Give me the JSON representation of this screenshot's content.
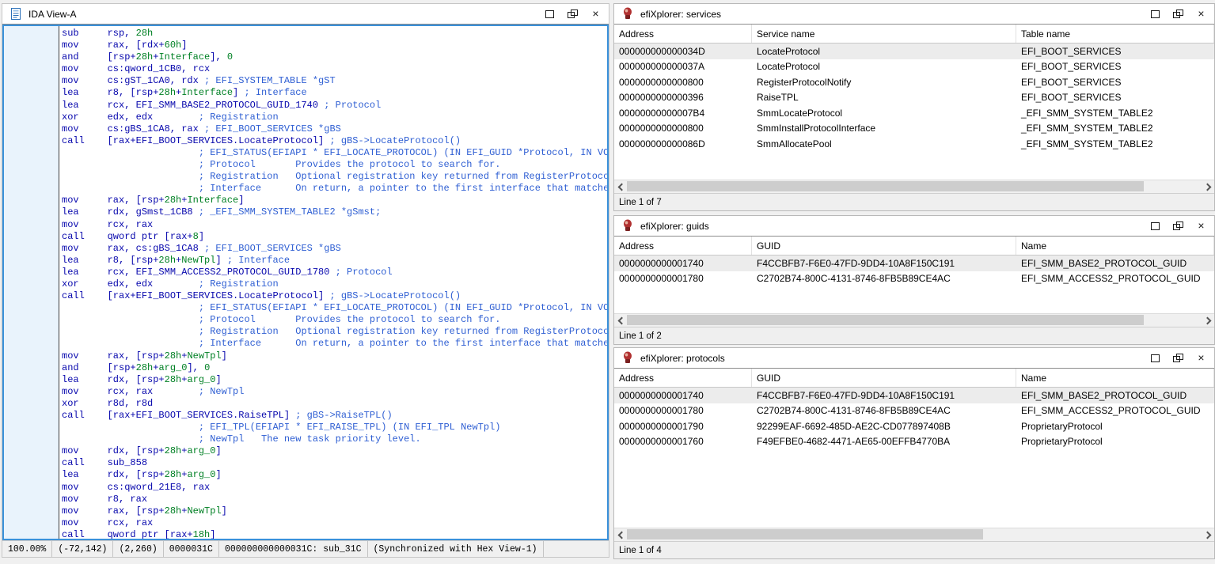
{
  "colors": {
    "accent_focus_border": "#3a91da",
    "code_navy": "#0707ad",
    "code_green": "#008024",
    "comment_blue": "#2f5fd3",
    "selected_row": "#ececec",
    "gutter_blue": "#e9f3fc"
  },
  "ida_view": {
    "title": "IDA View-A",
    "status_cells": [
      "100.00%",
      "(-72,142)",
      "(2,260)",
      "0000031C",
      "000000000000031C: sub_31C",
      "(Synchronized with Hex View-1)"
    ],
    "lines": [
      [
        [
          "c",
          "sub     rsp, "
        ],
        [
          "g",
          "28h"
        ]
      ],
      [
        [
          "c",
          "mov     rax, [rdx+"
        ],
        [
          "g",
          "60h"
        ],
        [
          "c",
          "]"
        ]
      ],
      [
        [
          "c",
          "and     [rsp+"
        ],
        [
          "g",
          "28h"
        ],
        [
          "c",
          "+"
        ],
        [
          "g",
          "Interface"
        ],
        [
          "c",
          "], "
        ],
        [
          "g",
          "0"
        ]
      ],
      [
        [
          "c",
          "mov     cs:qword_1CB0, rcx"
        ]
      ],
      [
        [
          "c",
          "mov     cs:gST_1CA0, rdx "
        ],
        [
          "b",
          "; EFI_SYSTEM_TABLE *gST"
        ]
      ],
      [
        [
          "c",
          "lea     r8, [rsp+"
        ],
        [
          "g",
          "28h"
        ],
        [
          "c",
          "+"
        ],
        [
          "g",
          "Interface"
        ],
        [
          "c",
          "] "
        ],
        [
          "b",
          "; Interface"
        ]
      ],
      [
        [
          "c",
          "lea     rcx, EFI_SMM_BASE2_PROTOCOL_GUID_1740 "
        ],
        [
          "b",
          "; Protocol"
        ]
      ],
      [
        [
          "c",
          "xor     edx, edx        "
        ],
        [
          "b",
          "; Registration"
        ]
      ],
      [
        [
          "c",
          "mov     cs:gBS_1CA8, rax "
        ],
        [
          "b",
          "; EFI_BOOT_SERVICES *gBS"
        ]
      ],
      [
        [
          "c",
          "call    [rax+EFI_BOOT_SERVICES.LocateProtocol] "
        ],
        [
          "b",
          "; gBS->LocateProtocol()"
        ]
      ],
      [
        [
          "b",
          "                        ; EFI_STATUS(EFIAPI * EFI_LOCATE_PROTOCOL) (IN EFI_GUID *Protocol, IN VOID"
        ]
      ],
      [
        [
          "b",
          "                        ; Protocol       Provides the protocol to search for."
        ]
      ],
      [
        [
          "b",
          "                        ; Registration   Optional registration key returned from RegisterProtocolNo"
        ]
      ],
      [
        [
          "b",
          "                        ; Interface      On return, a pointer to the first interface that matches t"
        ]
      ],
      [
        [
          "c",
          "mov     rax, [rsp+"
        ],
        [
          "g",
          "28h"
        ],
        [
          "c",
          "+"
        ],
        [
          "g",
          "Interface"
        ],
        [
          "c",
          "]"
        ]
      ],
      [
        [
          "c",
          "lea     rdx, gSmst_1CB8 "
        ],
        [
          "b",
          "; _EFI_SMM_SYSTEM_TABLE2 *gSmst;"
        ]
      ],
      [
        [
          "c",
          "mov     rcx, rax"
        ]
      ],
      [
        [
          "c",
          "call    qword ptr [rax+"
        ],
        [
          "g",
          "8"
        ],
        [
          "c",
          "]"
        ]
      ],
      [
        [
          "c",
          "mov     rax, cs:gBS_1CA8 "
        ],
        [
          "b",
          "; EFI_BOOT_SERVICES *gBS"
        ]
      ],
      [
        [
          "c",
          "lea     r8, [rsp+"
        ],
        [
          "g",
          "28h"
        ],
        [
          "c",
          "+"
        ],
        [
          "g",
          "NewTpl"
        ],
        [
          "c",
          "] "
        ],
        [
          "b",
          "; Interface"
        ]
      ],
      [
        [
          "c",
          "lea     rcx, EFI_SMM_ACCESS2_PROTOCOL_GUID_1780 "
        ],
        [
          "b",
          "; Protocol"
        ]
      ],
      [
        [
          "c",
          "xor     edx, edx        "
        ],
        [
          "b",
          "; Registration"
        ]
      ],
      [
        [
          "c",
          "call    [rax+EFI_BOOT_SERVICES.LocateProtocol] "
        ],
        [
          "b",
          "; gBS->LocateProtocol()"
        ]
      ],
      [
        [
          "b",
          "                        ; EFI_STATUS(EFIAPI * EFI_LOCATE_PROTOCOL) (IN EFI_GUID *Protocol, IN VOID"
        ]
      ],
      [
        [
          "b",
          "                        ; Protocol       Provides the protocol to search for."
        ]
      ],
      [
        [
          "b",
          "                        ; Registration   Optional registration key returned from RegisterProtocolNo"
        ]
      ],
      [
        [
          "b",
          "                        ; Interface      On return, a pointer to the first interface that matches t"
        ]
      ],
      [
        [
          "c",
          "mov     rax, [rsp+"
        ],
        [
          "g",
          "28h"
        ],
        [
          "c",
          "+"
        ],
        [
          "g",
          "NewTpl"
        ],
        [
          "c",
          "]"
        ]
      ],
      [
        [
          "c",
          "and     [rsp+"
        ],
        [
          "g",
          "28h"
        ],
        [
          "c",
          "+"
        ],
        [
          "g",
          "arg_0"
        ],
        [
          "c",
          "], "
        ],
        [
          "g",
          "0"
        ]
      ],
      [
        [
          "c",
          "lea     rdx, [rsp+"
        ],
        [
          "g",
          "28h"
        ],
        [
          "c",
          "+"
        ],
        [
          "g",
          "arg_0"
        ],
        [
          "c",
          "]"
        ]
      ],
      [
        [
          "c",
          "mov     rcx, rax        "
        ],
        [
          "b",
          "; NewTpl"
        ]
      ],
      [
        [
          "c",
          "xor     r8d, r8d"
        ]
      ],
      [
        [
          "c",
          "call    [rax+EFI_BOOT_SERVICES.RaiseTPL] "
        ],
        [
          "b",
          "; gBS->RaiseTPL()"
        ]
      ],
      [
        [
          "b",
          "                        ; EFI_TPL(EFIAPI * EFI_RAISE_TPL) (IN EFI_TPL NewTpl)"
        ]
      ],
      [
        [
          "b",
          "                        ; NewTpl   The new task priority level."
        ]
      ],
      [
        [
          "c",
          "mov     rdx, [rsp+"
        ],
        [
          "g",
          "28h"
        ],
        [
          "c",
          "+"
        ],
        [
          "g",
          "arg_0"
        ],
        [
          "c",
          "]"
        ]
      ],
      [
        [
          "c",
          "call    sub_858"
        ]
      ],
      [
        [
          "c",
          "lea     rdx, [rsp+"
        ],
        [
          "g",
          "28h"
        ],
        [
          "c",
          "+"
        ],
        [
          "g",
          "arg_0"
        ],
        [
          "c",
          "]"
        ]
      ],
      [
        [
          "c",
          "mov     cs:qword_21E8, rax"
        ]
      ],
      [
        [
          "c",
          "mov     r8, rax"
        ]
      ],
      [
        [
          "c",
          "mov     rax, [rsp+"
        ],
        [
          "g",
          "28h"
        ],
        [
          "c",
          "+"
        ],
        [
          "g",
          "NewTpl"
        ],
        [
          "c",
          "]"
        ]
      ],
      [
        [
          "c",
          "mov     rcx, rax"
        ]
      ],
      [
        [
          "c",
          "call    qword ptr [rax+"
        ],
        [
          "g",
          "18h"
        ],
        [
          "c",
          "]"
        ]
      ]
    ]
  },
  "panels": {
    "services": {
      "title": "efiXplorer: services",
      "columns": [
        "Address",
        "Service name",
        "Table name"
      ],
      "rows": [
        [
          "000000000000034D",
          "LocateProtocol",
          "EFI_BOOT_SERVICES"
        ],
        [
          "000000000000037A",
          "LocateProtocol",
          "EFI_BOOT_SERVICES"
        ],
        [
          "0000000000000800",
          "RegisterProtocolNotify",
          "EFI_BOOT_SERVICES"
        ],
        [
          "0000000000000396",
          "RaiseTPL",
          "EFI_BOOT_SERVICES"
        ],
        [
          "00000000000007B4",
          "SmmLocateProtocol",
          "_EFI_SMM_SYSTEM_TABLE2"
        ],
        [
          "0000000000000800",
          "SmmInstallProtocolInterface",
          "_EFI_SMM_SYSTEM_TABLE2"
        ],
        [
          "000000000000086D",
          "SmmAllocatePool",
          "_EFI_SMM_SYSTEM_TABLE2"
        ]
      ],
      "selected_row": 0,
      "status": "Line 1 of 7",
      "hthumb_pct": 90
    },
    "guids": {
      "title": "efiXplorer: guids",
      "columns": [
        "Address",
        "GUID",
        "Name"
      ],
      "rows": [
        [
          "0000000000001740",
          "F4CCBFB7-F6E0-47FD-9DD4-10A8F150C191",
          "EFI_SMM_BASE2_PROTOCOL_GUID"
        ],
        [
          "0000000000001780",
          "C2702B74-800C-4131-8746-8FB5B89CE4AC",
          "EFI_SMM_ACCESS2_PROTOCOL_GUID"
        ]
      ],
      "selected_row": 0,
      "status": "Line 1 of 2",
      "hthumb_pct": 90
    },
    "protocols": {
      "title": "efiXplorer: protocols",
      "columns": [
        "Address",
        "GUID",
        "Name"
      ],
      "rows": [
        [
          "0000000000001740",
          "F4CCBFB7-F6E0-47FD-9DD4-10A8F150C191",
          "EFI_SMM_BASE2_PROTOCOL_GUID"
        ],
        [
          "0000000000001780",
          "C2702B74-800C-4131-8746-8FB5B89CE4AC",
          "EFI_SMM_ACCESS2_PROTOCOL_GUID"
        ],
        [
          "0000000000001790",
          "92299EAF-6692-485D-AE2C-CD077897408B",
          "ProprietaryProtocol"
        ],
        [
          "0000000000001760",
          "F49EFBE0-4682-4471-AE65-00EFFB4770BA",
          "ProprietaryProtocol"
        ]
      ],
      "selected_row": 0,
      "status": "Line 1 of 4",
      "hthumb_pct": 62
    }
  }
}
